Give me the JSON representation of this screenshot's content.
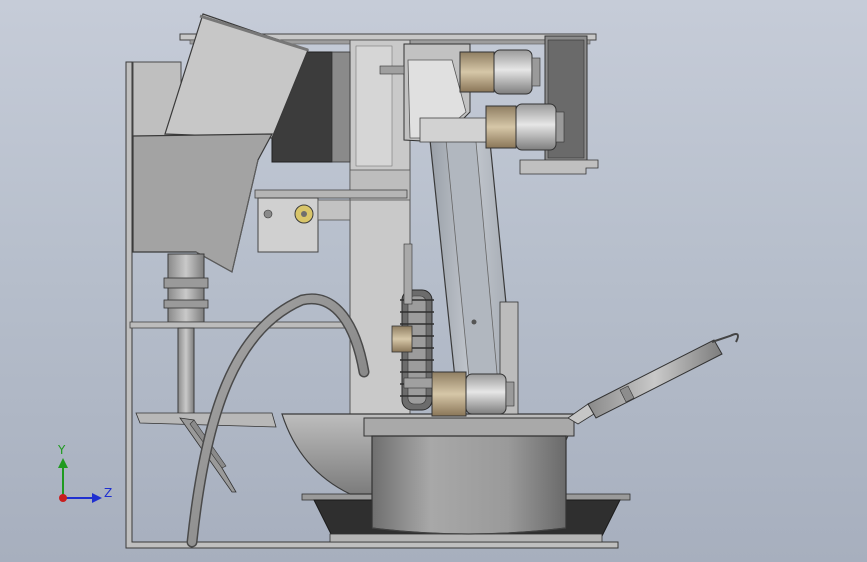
{
  "viewport": {
    "background_top": "#c6ccd8",
    "background_bottom": "#a7afbe"
  },
  "triad": {
    "y_label": "Y",
    "z_label": "Z",
    "y_color": "#1f9a1f",
    "z_color": "#1f2fd0",
    "origin_color": "#c81e1e"
  },
  "model": {
    "components": [
      "frame",
      "top-rail",
      "hopper",
      "hopper-chute",
      "back-plate",
      "dark-panel",
      "sensor-bracket",
      "coupling",
      "vertical-shaft",
      "flexible-hose",
      "scraper-blade",
      "mixing-bowl",
      "base-tray",
      "turntable-drum",
      "upper-arm",
      "gear-wheel",
      "servo-motor-upper",
      "servo-motor-middle",
      "servo-motor-lower",
      "right-motor-bracket",
      "tool-rod"
    ]
  }
}
